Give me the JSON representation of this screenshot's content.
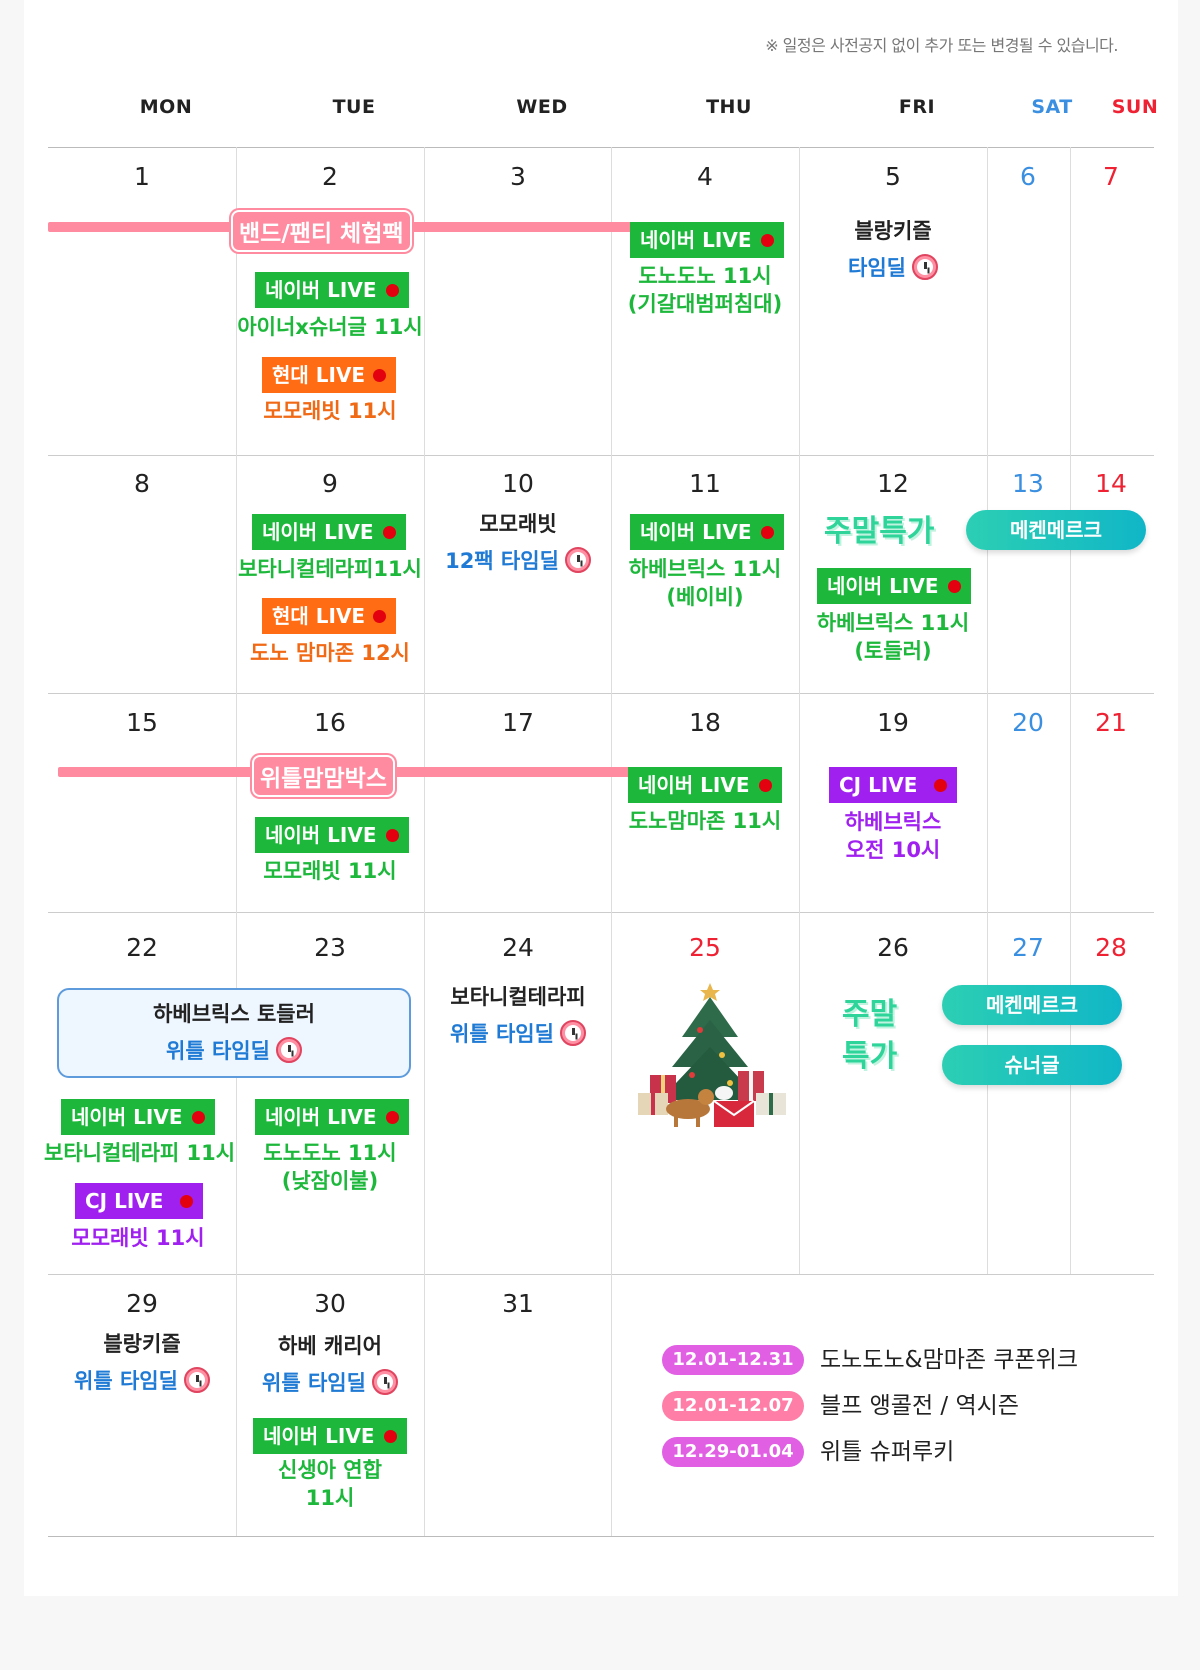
{
  "notice": "※ 일정은 사전공지 없이 추가 또는 변경될 수 있습니다.",
  "weekdays": [
    "MON",
    "TUE",
    "WED",
    "THU",
    "FRI",
    "SAT",
    "SUN"
  ],
  "colors": {
    "naver": "#1db83b",
    "hyundai": "#ff6c14",
    "cj": "#a020f0",
    "sat": "#3b8fe0",
    "sun": "#ee2233",
    "bar": "#ff8ba0"
  },
  "days": [
    "1",
    "2",
    "3",
    "4",
    "5",
    "6",
    "7",
    "8",
    "9",
    "10",
    "11",
    "12",
    "13",
    "14",
    "15",
    "16",
    "17",
    "18",
    "19",
    "20",
    "21",
    "22",
    "23",
    "24",
    "25",
    "26",
    "27",
    "28",
    "29",
    "30",
    "31"
  ],
  "bars": {
    "week1": "밴드/팬티 체험팩",
    "week3": "위틀맘맘박스"
  },
  "live": {
    "naver": "네이버 LIVE",
    "hyundai": "현대 LIVE",
    "cj": "CJ LIVE"
  },
  "events": {
    "d2_naver": "아이너x슈너글 11시",
    "d2_hyundai": "모모래빗 11시",
    "d4_naver_1": "도노도노 11시",
    "d4_naver_2": "(기갈대범퍼침대)",
    "d5_title": "블랑키즐",
    "d5_deal": "타임딜",
    "d9_naver": "보타니컬테라피11시",
    "d9_hyundai": "도노 맘마존 12시",
    "d10_title": "모모래빗",
    "d10_deal": "12팩 타임딜",
    "d11_naver_1": "하베브릭스 11시",
    "d11_naver_2": "(베이비)",
    "d12_weekend": "주말특가",
    "d12_naver_1": "하베브릭스 11시",
    "d12_naver_2": "(토들러)",
    "d13_pill": "메켄메르크",
    "d16_naver": "모모래빗 11시",
    "d18_naver": "도노맘마존 11시",
    "d19_cj_1": "하베브릭스",
    "d19_cj_2": "오전 10시",
    "d22_box_1": "하베브릭스 토들러",
    "d22_box_2": "위틀 타임딜",
    "d22_naver": "보타니컬테라피 11시",
    "d22_cj": "모모래빗 11시",
    "d23_naver_1": "도노도노 11시",
    "d23_naver_2": "(낮잠이불)",
    "d24_title": "보타니컬테라피",
    "d24_deal": "위틀 타임딜",
    "d26_weekend_1": "주말",
    "d26_weekend_2": "특가",
    "d26_pill_1": "메켄메르크",
    "d26_pill_2": "슈너글",
    "d29_title": "블랑키즐",
    "d29_deal": "위틀 타임딜",
    "d30_title": "하베 캐리어",
    "d30_deal": "위틀 타임딜",
    "d30_naver_1": "신생아 연합",
    "d30_naver_2": "11시"
  },
  "ranges": [
    {
      "date": "12.01-12.31",
      "text": "도노도노&맘마존 쿠폰위크"
    },
    {
      "date": "12.01-12.07",
      "text": "블프 앵콜전 / 역시즌"
    },
    {
      "date": "12.29-01.04",
      "text": "위틀 슈퍼루키"
    }
  ],
  "icons": [
    "alarm-clock-icon",
    "christmas-tree-icon",
    "live-dot-icon"
  ]
}
